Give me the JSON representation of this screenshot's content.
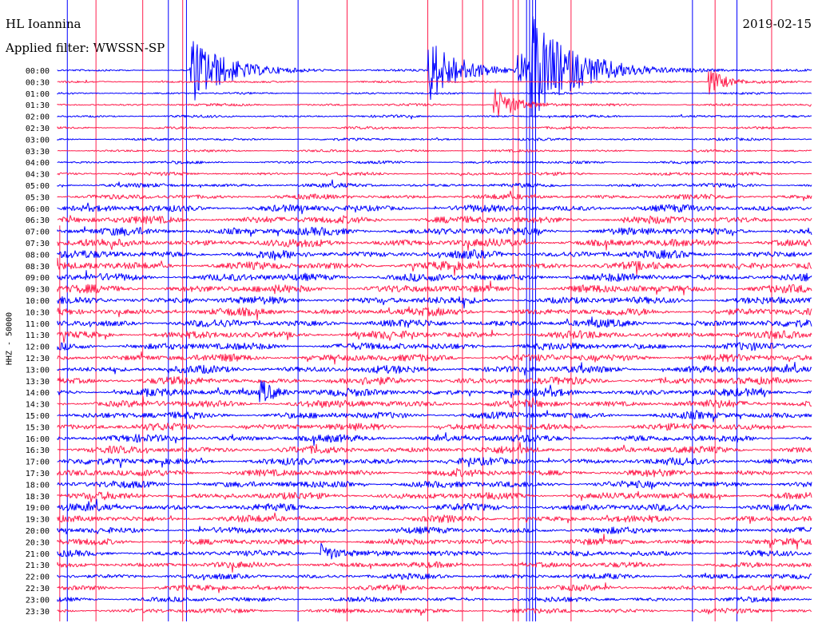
{
  "header": {
    "station": "HL Ioannina",
    "filter": "Applied filter: WWSSN-SP",
    "date": "2019-02-15",
    "channel": "HHZ - 50000"
  },
  "colors": {
    "even_trace": "#0000ff",
    "odd_trace": "#ff1f4e",
    "background": "#ffffff"
  },
  "chart_data": {
    "type": "line",
    "title": "HL Ioannina",
    "subtitle": "Applied filter: WWSSN-SP",
    "ylabel": "HHZ - 50000",
    "row_labels": [
      "00:00",
      "00:30",
      "01:00",
      "01:30",
      "02:00",
      "02:30",
      "03:00",
      "03:30",
      "04:00",
      "04:30",
      "05:00",
      "05:30",
      "06:00",
      "06:30",
      "07:00",
      "07:30",
      "08:00",
      "08:30",
      "09:00",
      "09:30",
      "10:00",
      "10:30",
      "11:00",
      "11:30",
      "12:00",
      "12:30",
      "13:00",
      "13:30",
      "14:00",
      "14:30",
      "15:00",
      "15:30",
      "16:00",
      "16:30",
      "17:00",
      "17:30",
      "18:00",
      "18:30",
      "19:00",
      "19:30",
      "20:00",
      "20:30",
      "21:00",
      "21:30",
      "22:00",
      "22:30",
      "23:00",
      "23:30"
    ],
    "noise_level_by_row": [
      0.25,
      0.25,
      0.25,
      0.3,
      0.3,
      0.3,
      0.3,
      0.3,
      0.35,
      0.4,
      0.5,
      0.6,
      0.85,
      0.9,
      0.95,
      0.95,
      0.95,
      0.95,
      0.95,
      0.95,
      0.9,
      0.9,
      0.9,
      0.9,
      0.9,
      0.9,
      0.9,
      0.9,
      0.9,
      0.9,
      0.85,
      0.85,
      0.85,
      0.85,
      0.85,
      0.85,
      0.85,
      0.85,
      0.85,
      0.8,
      0.75,
      0.75,
      0.7,
      0.7,
      0.65,
      0.65,
      0.6,
      0.6
    ],
    "events": [
      {
        "row": 0,
        "x_fraction": 0.176,
        "amplitude": 6.0,
        "decay": 0.045
      },
      {
        "row": 0,
        "x_fraction": 0.493,
        "amplitude": 5.5,
        "decay": 0.04
      },
      {
        "row": 0,
        "x_fraction": 0.63,
        "amplitude": 8.0,
        "decay": 0.06
      },
      {
        "row": 0,
        "x_fraction": 0.612,
        "amplitude": 3.0,
        "decay": 0.02
      },
      {
        "row": 1,
        "x_fraction": 0.865,
        "amplitude": 2.5,
        "decay": 0.02
      },
      {
        "row": 3,
        "x_fraction": 0.58,
        "amplitude": 3.0,
        "decay": 0.025
      },
      {
        "row": 28,
        "x_fraction": 0.27,
        "amplitude": 2.0,
        "decay": 0.02
      },
      {
        "row": 42,
        "x_fraction": 0.35,
        "amplitude": 1.8,
        "decay": 0.02
      }
    ],
    "spikes": [
      {
        "x_fraction": 0.003,
        "from_row": 14,
        "to_row": 47,
        "color": "odd"
      },
      {
        "x_fraction": 0.013,
        "from_row": 0,
        "to_row": 47,
        "color": "even"
      },
      {
        "x_fraction": 0.051,
        "from_row": 0,
        "to_row": 47,
        "color": "odd"
      },
      {
        "x_fraction": 0.113,
        "from_row": 0,
        "to_row": 47,
        "color": "odd"
      },
      {
        "x_fraction": 0.147,
        "from_row": 0,
        "to_row": 47,
        "color": "even"
      },
      {
        "x_fraction": 0.166,
        "from_row": 0,
        "to_row": 47,
        "color": "odd"
      },
      {
        "x_fraction": 0.171,
        "from_row": 0,
        "to_row": 47,
        "color": "even"
      },
      {
        "x_fraction": 0.319,
        "from_row": 0,
        "to_row": 47,
        "color": "even"
      },
      {
        "x_fraction": 0.384,
        "from_row": 0,
        "to_row": 47,
        "color": "odd"
      },
      {
        "x_fraction": 0.491,
        "from_row": 0,
        "to_row": 47,
        "color": "odd"
      },
      {
        "x_fraction": 0.537,
        "from_row": 0,
        "to_row": 47,
        "color": "odd"
      },
      {
        "x_fraction": 0.564,
        "from_row": 0,
        "to_row": 47,
        "color": "odd"
      },
      {
        "x_fraction": 0.604,
        "from_row": 0,
        "to_row": 47,
        "color": "odd"
      },
      {
        "x_fraction": 0.611,
        "from_row": 0,
        "to_row": 47,
        "color": "odd"
      },
      {
        "x_fraction": 0.622,
        "from_row": 0,
        "to_row": 47,
        "color": "even"
      },
      {
        "x_fraction": 0.626,
        "from_row": 0,
        "to_row": 47,
        "color": "even"
      },
      {
        "x_fraction": 0.63,
        "from_row": 0,
        "to_row": 47,
        "color": "even"
      },
      {
        "x_fraction": 0.634,
        "from_row": 0,
        "to_row": 47,
        "color": "even"
      },
      {
        "x_fraction": 0.681,
        "from_row": 0,
        "to_row": 47,
        "color": "odd"
      },
      {
        "x_fraction": 0.842,
        "from_row": 0,
        "to_row": 47,
        "color": "even"
      },
      {
        "x_fraction": 0.872,
        "from_row": 0,
        "to_row": 47,
        "color": "odd"
      },
      {
        "x_fraction": 0.901,
        "from_row": 0,
        "to_row": 47,
        "color": "even"
      },
      {
        "x_fraction": 0.947,
        "from_row": 0,
        "to_row": 47,
        "color": "odd"
      }
    ]
  }
}
